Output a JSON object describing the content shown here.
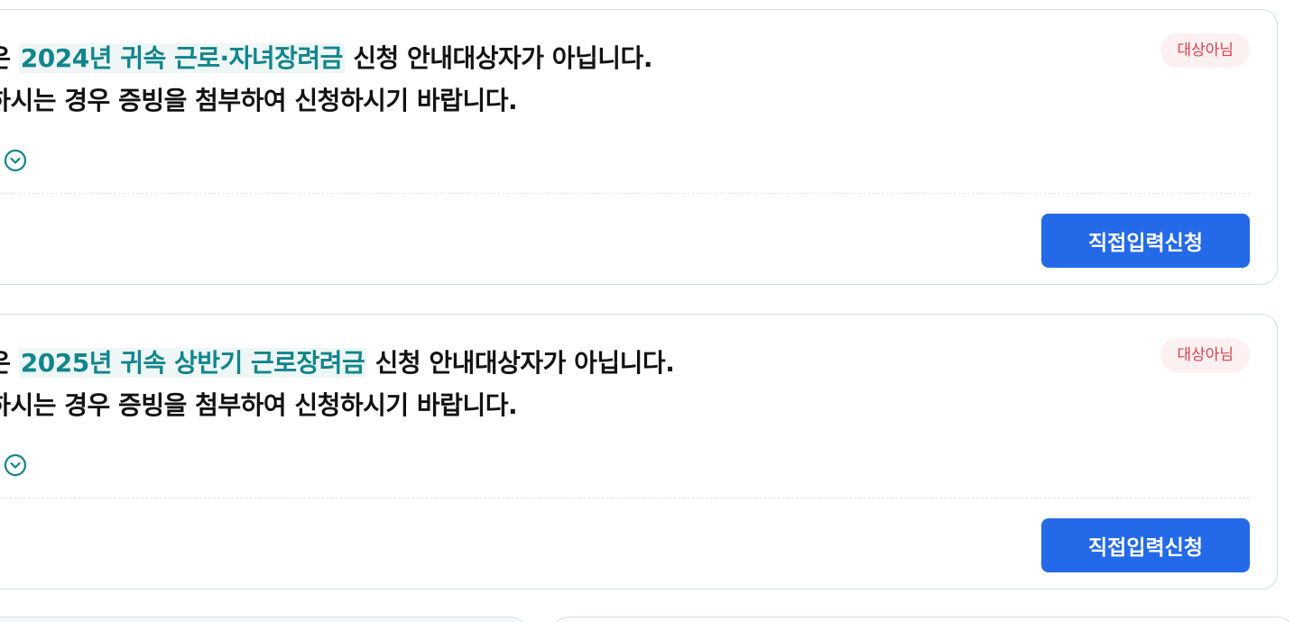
{
  "cards": [
    {
      "prefix": "님은 ",
      "highlight": "2024년 귀속 근로·자녀장려금",
      "suffix": " 신청 안내대상자가 아닙니다.",
      "line2": " 원하시는 경우 증빙을 첨부하여 신청하시기 바랍니다.",
      "more_label": "보기",
      "badge": "대상아님",
      "button": "직접입력신청"
    },
    {
      "prefix": "님은 ",
      "highlight": "2025년 귀속 상반기 근로장려금",
      "suffix": " 신청 안내대상자가 아닙니다.",
      "line2": " 원하시는 경우 증빙을 첨부하여 신청하시기 바랍니다.",
      "more_label": "보기",
      "badge": "대상아님",
      "button": "직접입력신청"
    }
  ],
  "colors": {
    "accent_teal": "#12858c",
    "badge_red": "#e0404a",
    "button_blue": "#246ae8"
  },
  "icons": {
    "more": "chevron-down-circle-icon"
  }
}
